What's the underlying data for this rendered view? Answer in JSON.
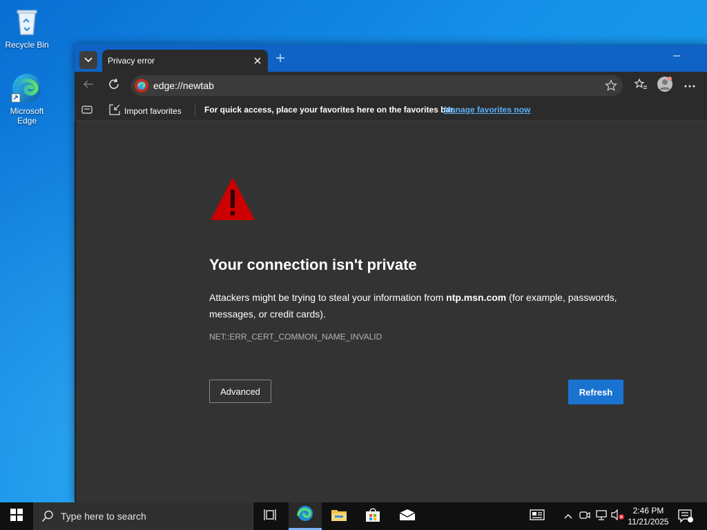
{
  "desktop": {
    "icons": [
      {
        "label": "Recycle Bin",
        "icon": "recycle-bin-icon"
      },
      {
        "label": "Microsoft Edge",
        "icon": "edge-icon"
      }
    ]
  },
  "browser": {
    "tab": {
      "title": "Privacy error",
      "close_icon": "close-icon"
    },
    "address": {
      "url": "edge://newtab"
    },
    "favorites_bar": {
      "import_label": "Import favorites",
      "hint": "For quick access, place your favorites here on the favorites bar.",
      "manage_link": "Manage favorites now"
    },
    "error": {
      "title": "Your connection isn't private",
      "body_prefix": "Attackers might be trying to steal your information from ",
      "host": "ntp.msn.com",
      "body_suffix": " (for example, passwords, messages, or credit cards).",
      "code": "NET::ERR_CERT_COMMON_NAME_INVALID",
      "advanced_label": "Advanced",
      "refresh_label": "Refresh"
    },
    "colors": {
      "titlebar": "#0f63c4",
      "toolbar": "#2b2b2b",
      "content": "#333333",
      "accent": "#1a73d1",
      "warning": "#cc0000",
      "link": "#5ab0f7"
    }
  },
  "taskbar": {
    "search_placeholder": "Type here to search",
    "time": "2:46 PM",
    "date": "11/21/2025"
  }
}
